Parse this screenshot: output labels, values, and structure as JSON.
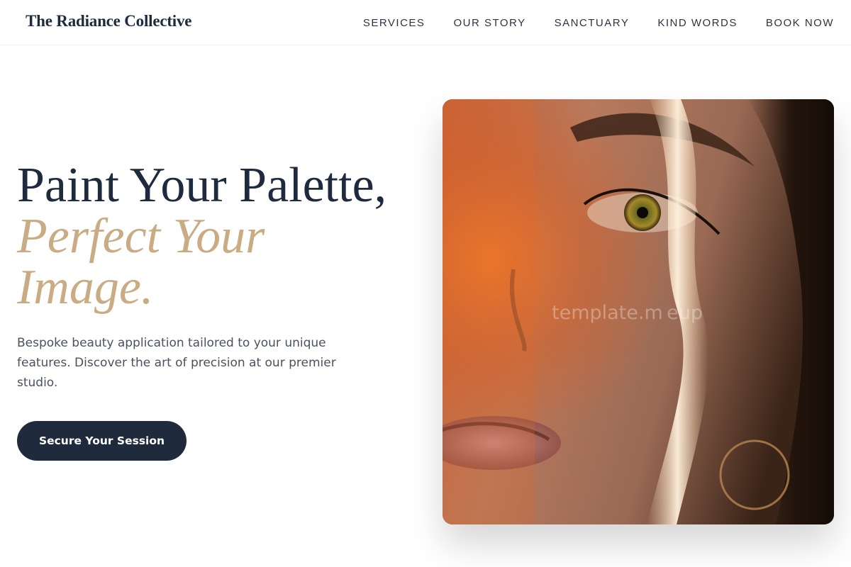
{
  "header": {
    "logo": "The Radiance Collective",
    "nav": [
      {
        "label": "SERVICES"
      },
      {
        "label": "OUR STORY"
      },
      {
        "label": "SANCTUARY"
      },
      {
        "label": "KIND WORDS"
      },
      {
        "label": "BOOK NOW"
      }
    ]
  },
  "hero": {
    "title_line1": "Paint Your Palette,",
    "title_accent": "Perfect Your Image.",
    "description": "Bespoke beauty application tailored to your unique features. Discover the art of precision at our premier studio.",
    "cta_label": "Secure Your Session",
    "image_watermark": "template.m eup"
  },
  "colors": {
    "primary": "#1e2a3d",
    "accent": "#c9ab84",
    "body_text": "#4a5161"
  }
}
